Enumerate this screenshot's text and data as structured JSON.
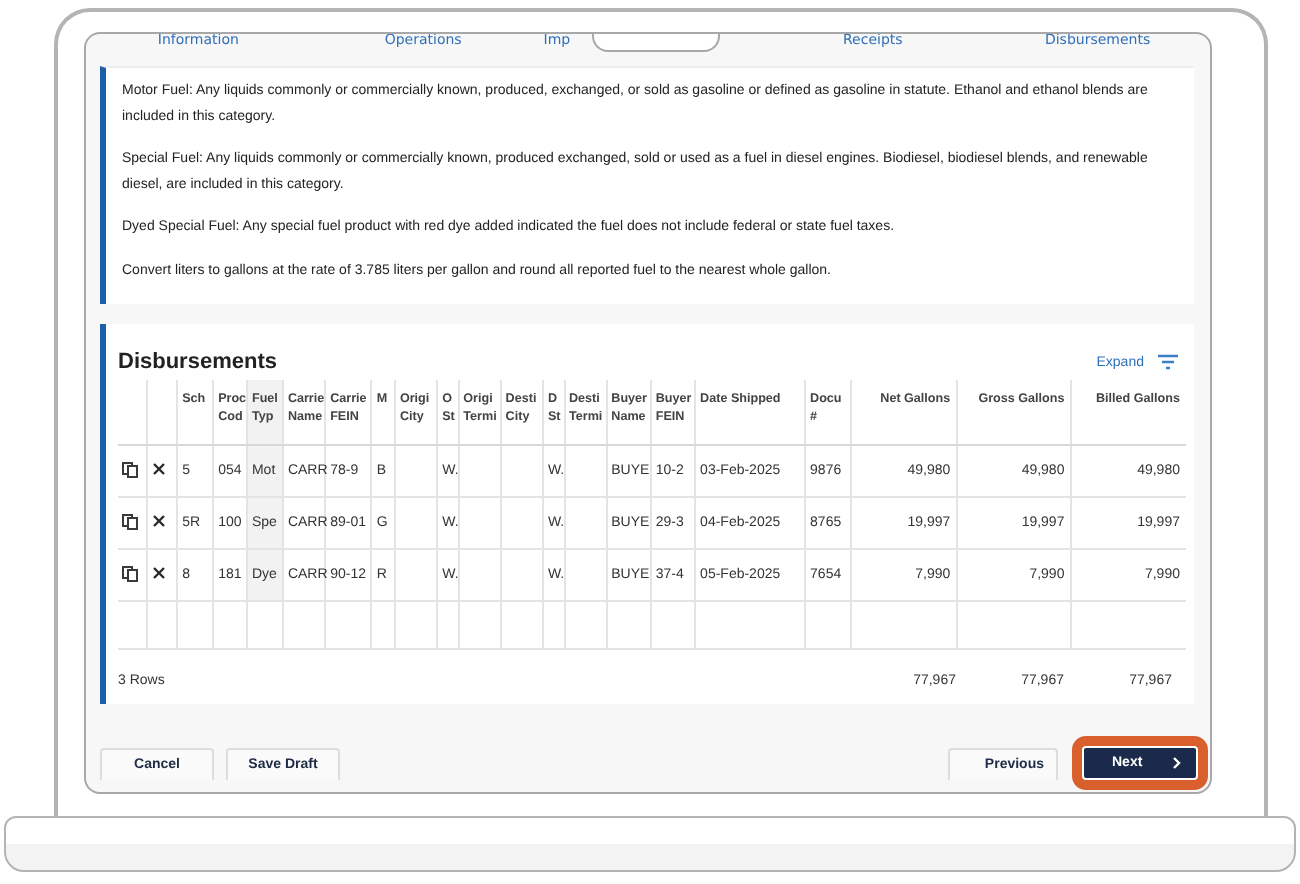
{
  "tabs": [
    {
      "label": "Information"
    },
    {
      "label": "Operations"
    },
    {
      "label": "Imp"
    },
    {
      "label": "Receipts"
    },
    {
      "label": "Disbursements"
    }
  ],
  "notes": [
    "Motor Fuel: Any liquids commonly or commercially known, produced, exchanged, or sold as gasoline or defined as gasoline in statute. Ethanol and ethanol blends are included in this category.",
    "Special Fuel: Any liquids commonly or commercially known, produced exchanged, sold or used as a fuel in diesel engines. Biodiesel, biodiesel blends, and renewable diesel, are included in this category.",
    "Dyed Special Fuel: Any special fuel product with red dye added indicated the fuel does not include federal or state fuel taxes.",
    "Convert liters to gallons at the rate of 3.785 liters per gallon and round all reported fuel to the nearest whole gallon."
  ],
  "table": {
    "title": "Disbursements",
    "expand": "Expand",
    "columns": [
      "Sch",
      "Proc Cod",
      "Fuel Typ",
      "Carrie Name",
      "Carrie FEIN",
      "M",
      "Origi City",
      "O St",
      "Origi Termi",
      "Desti City",
      "D St",
      "Desti Termi",
      "Buyer Name",
      "Buyer FEIN",
      "Date Shipped",
      "Docu #",
      "Net Gallons",
      "Gross Gallons",
      "Billed Gallons"
    ],
    "rows": [
      [
        "5",
        "054",
        "Mot",
        "CARR",
        "78-9",
        "B",
        "",
        "W.",
        "",
        "",
        "W.",
        "",
        "BUYE",
        "10-2",
        "03-Feb-2025",
        "9876",
        "49,980",
        "49,980",
        "49,980"
      ],
      [
        "5R",
        "100",
        "Spe",
        "CARR",
        "89-01",
        "G",
        "",
        "W.",
        "",
        "",
        "W.",
        "",
        "BUYE",
        "29-3",
        "04-Feb-2025",
        "8765",
        "19,997",
        "19,997",
        "19,997"
      ],
      [
        "8",
        "181",
        "Dye",
        "CARR",
        "90-12",
        "R",
        "",
        "W.",
        "",
        "",
        "W.",
        "",
        "BUYE",
        "37-4",
        "05-Feb-2025",
        "7654",
        "7,990",
        "7,990",
        "7,990"
      ]
    ],
    "row_count": "3 Rows",
    "totals": [
      "77,967",
      "77,967",
      "77,967"
    ]
  },
  "buttons": [
    {
      "label": "Cancel",
      "kind": "secondary",
      "highlighted": false
    },
    {
      "label": "Save Draft",
      "kind": "secondary",
      "highlighted": false
    },
    {
      "label": "Previous",
      "kind": "previous",
      "highlighted": false
    },
    {
      "label": "Next",
      "kind": "next",
      "highlighted": true
    }
  ]
}
